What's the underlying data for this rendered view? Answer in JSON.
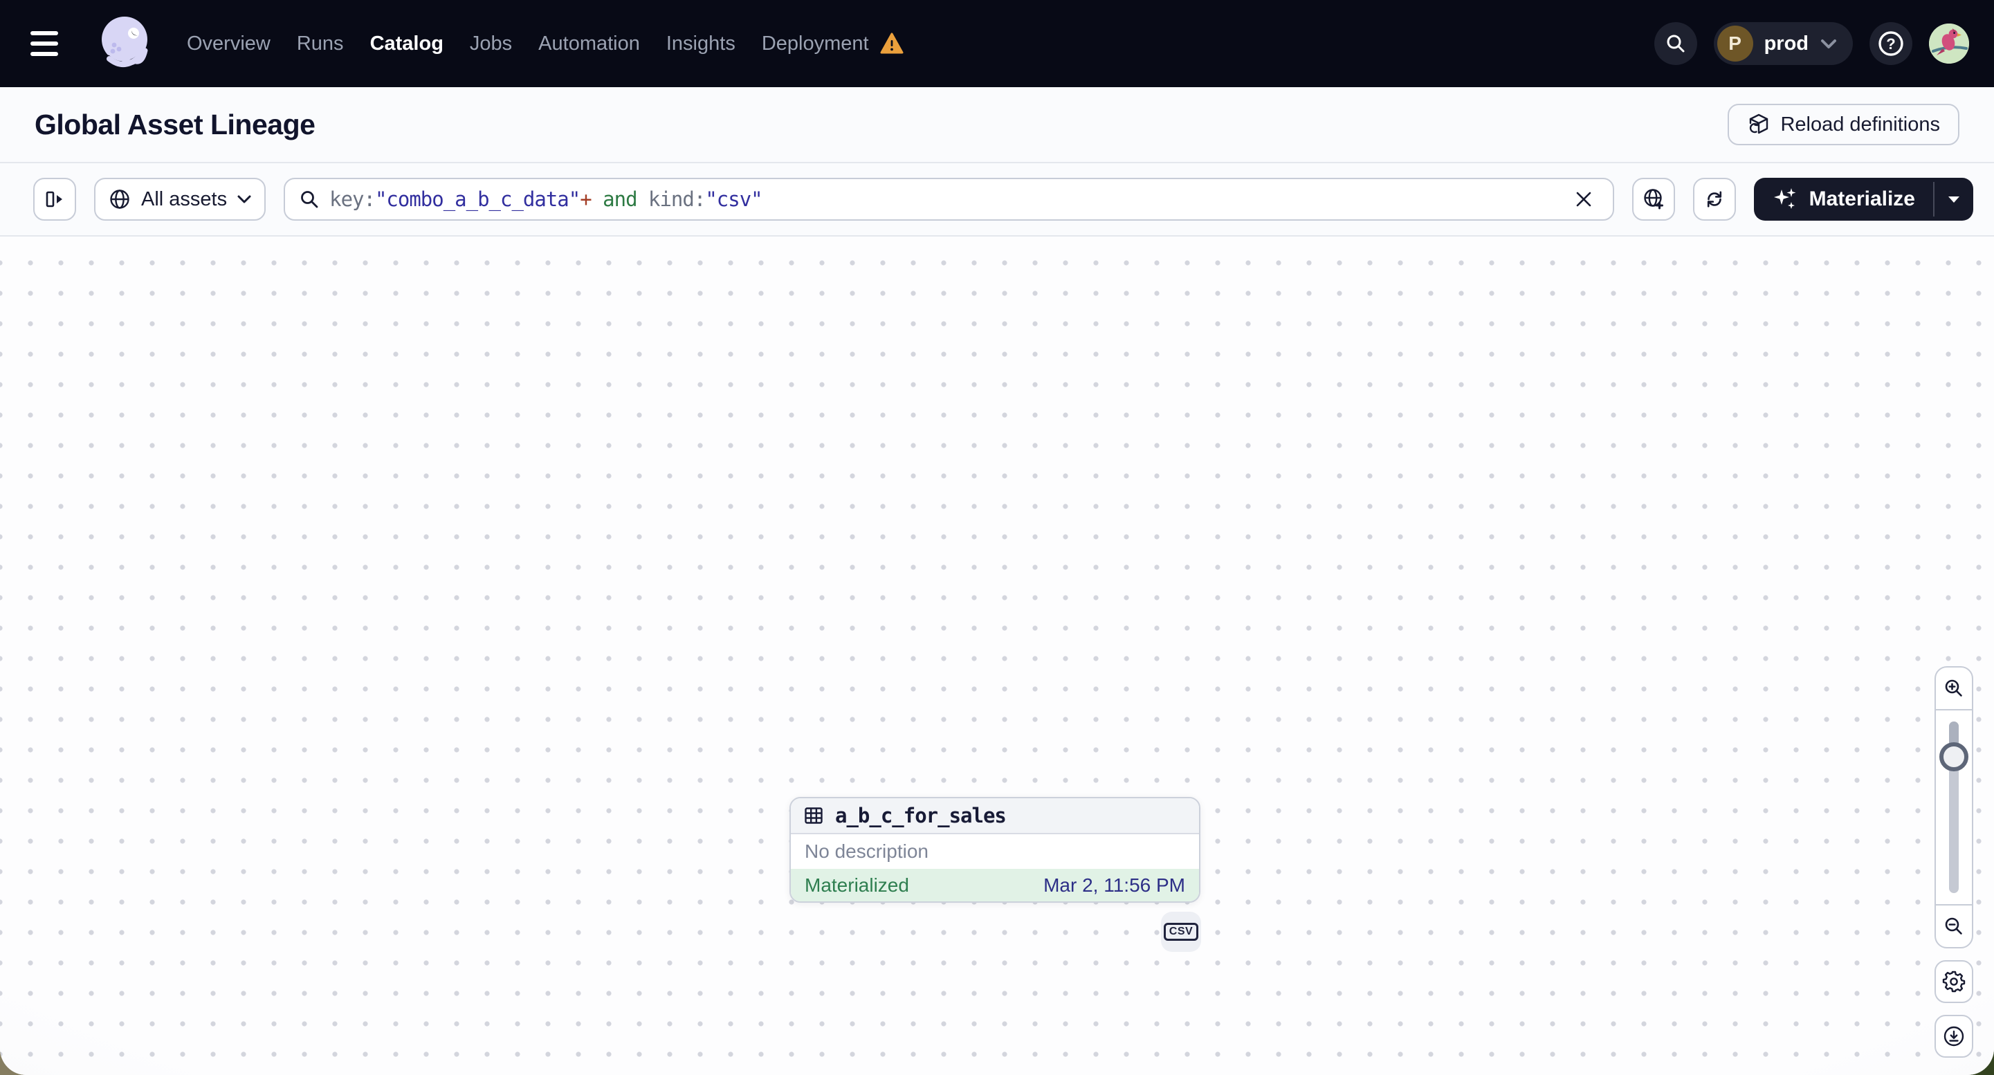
{
  "nav": {
    "items": [
      {
        "label": "Overview"
      },
      {
        "label": "Runs"
      },
      {
        "label": "Catalog"
      },
      {
        "label": "Jobs"
      },
      {
        "label": "Automation"
      },
      {
        "label": "Insights"
      },
      {
        "label": "Deployment"
      }
    ],
    "active_item": "Catalog",
    "deployment_switcher": {
      "avatar_initial": "P",
      "label": "prod"
    }
  },
  "header": {
    "title": "Global Asset Lineage",
    "reload_button_label": "Reload definitions"
  },
  "toolbar": {
    "asset_group_filter_label": "All assets",
    "search_query": "key:\"combo_a_b_c_data\"+ and kind:\"csv\"",
    "search_query_tokens": [
      {
        "text": "key:",
        "color": "#6a7180"
      },
      {
        "text": "\"combo_a_b_c_data\"",
        "color": "#322f9f"
      },
      {
        "text": "+",
        "color": "#a33d25"
      },
      {
        "text": " and ",
        "color": "#2d7a43"
      },
      {
        "text": "kind:",
        "color": "#6a7180"
      },
      {
        "text": "\"csv\"",
        "color": "#322f9f"
      }
    ],
    "materialize_label": "Materialize"
  },
  "lineage": {
    "node": {
      "name": "a_b_c_for_sales",
      "description": "No description",
      "status": "Materialized",
      "materialized_at": "Mar 2, 11:56 PM",
      "kind_tag": "CSV"
    }
  },
  "colors": {
    "materialized_text": "#2e7e4f",
    "materialized_bg": "#e1f2e6",
    "timestamp_text": "#2d2f87",
    "warning_orange": "#eba03c",
    "materialize_button_bg": "#161929",
    "query_string_blue": "#322f9f"
  }
}
